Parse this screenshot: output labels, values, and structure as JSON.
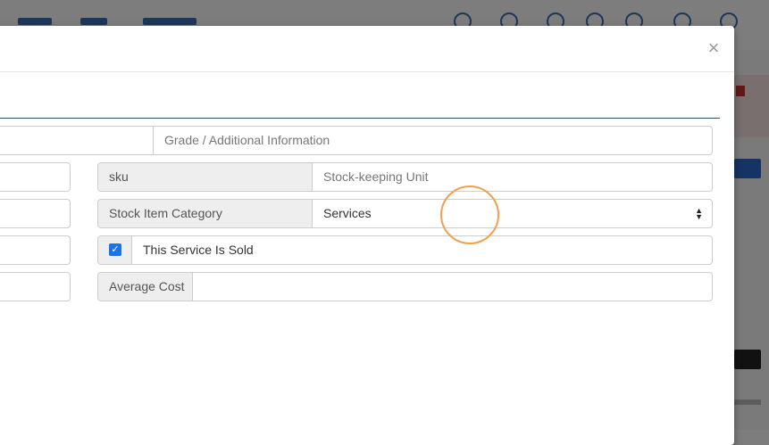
{
  "modal": {
    "close_label": "×"
  },
  "form": {
    "grade_placeholder": "Grade / Additional Information",
    "sku": {
      "label": "sku",
      "placeholder": "Stock-keeping Unit"
    },
    "category": {
      "label": "Stock Item Category",
      "value": "Services",
      "caret": "▲▼"
    },
    "sold": {
      "label": "This Service Is Sold",
      "checked": true,
      "check_glyph": "✓"
    },
    "average_cost": {
      "label": "Average Cost",
      "value": ""
    }
  },
  "colors": {
    "checkbox": "#1a73e8",
    "cursor_ring": "#f0a050",
    "tab_underline": "#2f4f5f"
  }
}
